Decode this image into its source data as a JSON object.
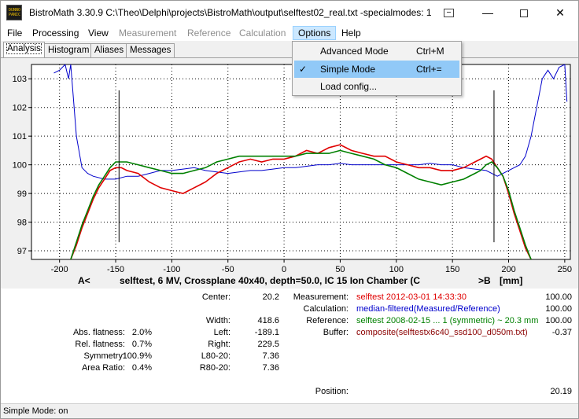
{
  "window": {
    "logo_text": [
      "DUNNO",
      "PANIC"
    ],
    "title": "BistroMath 3.30.9   C:\\Theo\\Delphi\\projects\\BistroMath\\output\\selftest02_real.txt -specialmodes: 1",
    "minimize_glyph": "—",
    "close_glyph": "✕"
  },
  "menu": {
    "file": "File",
    "processing": "Processing",
    "view": "View",
    "measurement": "Measurement",
    "reference": "Reference",
    "calculation": "Calculation",
    "options": "Options",
    "help": "Help"
  },
  "tabs": {
    "analysis": "Analysis",
    "histogram": "Histogram",
    "aliases": "Aliases",
    "messages": "Messages"
  },
  "options_menu": {
    "advanced_mode": "Advanced Mode",
    "advanced_shortcut": "Ctrl+M",
    "simple_mode": "Simple Mode",
    "simple_shortcut": "Ctrl+=",
    "simple_checked": true,
    "check_glyph": "✓",
    "load_config": "Load config..."
  },
  "chart_data": {
    "type": "line",
    "title": "selftest, 6 MV, Crossplane 40x40, depth=50.0, IC 15 Ion Chamber (C",
    "left_marker": "A<",
    "right_marker": ">B",
    "xlabel": "[mm]",
    "xlim": [
      -225,
      255
    ],
    "ylim": [
      96.7,
      103.5
    ],
    "x_ticks": [
      -200,
      -150,
      -100,
      -50,
      0,
      50,
      100,
      150,
      200,
      250
    ],
    "y_ticks": [
      97,
      98,
      99,
      100,
      101,
      102,
      103
    ],
    "markers_x": [
      -147,
      187
    ],
    "series": [
      {
        "color": "#0000cc",
        "x": [
          -205,
          -200,
          -195,
          -192,
          -190,
          -188,
          -185,
          -180,
          -175,
          -170,
          -160,
          -150,
          -140,
          -130,
          -120,
          -110,
          -100,
          -90,
          -80,
          -70,
          -60,
          -50,
          -40,
          -30,
          -20,
          -10,
          0,
          10,
          20,
          30,
          40,
          50,
          60,
          70,
          80,
          90,
          100,
          110,
          120,
          130,
          140,
          150,
          160,
          170,
          180,
          190,
          200,
          210,
          215,
          220,
          225,
          230,
          235,
          240,
          245,
          250,
          252
        ],
        "y": [
          103.2,
          103.3,
          103.5,
          103.0,
          103.5,
          102.5,
          101.0,
          99.9,
          99.7,
          99.6,
          99.5,
          99.5,
          99.6,
          99.6,
          99.7,
          99.8,
          99.8,
          99.85,
          99.9,
          99.8,
          99.75,
          99.7,
          99.75,
          99.8,
          99.8,
          99.85,
          99.9,
          99.9,
          99.95,
          100.0,
          100.0,
          100.05,
          100.0,
          100.0,
          100.0,
          100.0,
          100.0,
          100.0,
          100.0,
          100.05,
          100.0,
          100.0,
          99.9,
          99.85,
          99.8,
          99.6,
          99.8,
          100.0,
          100.3,
          101.0,
          102.0,
          103.0,
          103.3,
          103.0,
          103.4,
          103.5,
          102.2
        ]
      },
      {
        "color": "#e00000",
        "x": [
          -190,
          -185,
          -180,
          -175,
          -170,
          -165,
          -160,
          -155,
          -150,
          -145,
          -140,
          -130,
          -120,
          -110,
          -100,
          -90,
          -80,
          -70,
          -60,
          -50,
          -40,
          -30,
          -20,
          -10,
          0,
          10,
          20,
          30,
          40,
          50,
          60,
          70,
          80,
          90,
          100,
          110,
          120,
          130,
          140,
          150,
          160,
          170,
          175,
          180,
          185,
          190,
          195,
          200,
          205,
          210,
          215,
          220
        ],
        "y": [
          96.7,
          97.2,
          97.8,
          98.3,
          98.8,
          99.2,
          99.5,
          99.8,
          99.9,
          99.9,
          99.8,
          99.7,
          99.4,
          99.2,
          99.1,
          99.0,
          99.2,
          99.4,
          99.7,
          99.9,
          100.1,
          100.2,
          100.1,
          100.2,
          100.2,
          100.3,
          100.5,
          100.4,
          100.6,
          100.7,
          100.5,
          100.4,
          100.3,
          100.3,
          100.1,
          100.0,
          99.9,
          99.9,
          99.8,
          99.8,
          99.9,
          100.1,
          100.2,
          100.3,
          100.2,
          99.9,
          99.6,
          99.0,
          98.3,
          97.7,
          97.1,
          96.7
        ]
      },
      {
        "color": "#008000",
        "x": [
          -190,
          -185,
          -180,
          -175,
          -170,
          -165,
          -160,
          -155,
          -150,
          -145,
          -140,
          -130,
          -120,
          -110,
          -100,
          -90,
          -80,
          -70,
          -60,
          -50,
          -40,
          -30,
          -20,
          -10,
          0,
          10,
          20,
          30,
          40,
          50,
          60,
          70,
          80,
          90,
          100,
          110,
          120,
          130,
          140,
          150,
          160,
          170,
          175,
          180,
          185,
          190,
          195,
          200,
          205,
          210,
          215,
          220
        ],
        "y": [
          96.7,
          97.3,
          97.9,
          98.4,
          98.9,
          99.3,
          99.6,
          99.9,
          100.1,
          100.1,
          100.1,
          100.0,
          99.9,
          99.8,
          99.7,
          99.7,
          99.8,
          99.9,
          100.1,
          100.2,
          100.3,
          100.3,
          100.3,
          100.3,
          100.3,
          100.3,
          100.4,
          100.4,
          100.4,
          100.5,
          100.4,
          100.3,
          100.2,
          100.0,
          99.9,
          99.7,
          99.5,
          99.4,
          99.3,
          99.4,
          99.5,
          99.7,
          99.8,
          100.0,
          100.1,
          99.9,
          99.6,
          99.1,
          98.4,
          97.8,
          97.2,
          96.7
        ]
      }
    ]
  },
  "analysis": {
    "center_label": "Center:",
    "center": "20.2",
    "width_label": "Width:",
    "width": "418.6",
    "left_label": "Left:",
    "left": "-189.1",
    "right_label": "Right:",
    "right": "229.5",
    "l80_label": "L80-20:",
    "l80": "7.36",
    "r80_label": "R80-20:",
    "r80": "7.36",
    "abs_flatness_label": "Abs. flatness:",
    "abs_flatness": "2.0%",
    "rel_flatness_label": "Rel. flatness:",
    "rel_flatness": "0.7%",
    "symmetry_label": "Symmetry:",
    "symmetry": "100.9%",
    "area_ratio_label": "Area Ratio:",
    "area_ratio": "0.4%",
    "measurement_label": "Measurement:",
    "measurement": "selftest 2012-03-01 14:33:30",
    "measurement_value": "100.00",
    "calculation_label": "Calculation:",
    "calculation": "median-filtered(Measured/Reference)",
    "calculation_value": "100.00",
    "reference_label": "Reference:",
    "reference": "selftest 2008-02-15  ... 1 (symmetric) ~ 20.3 mm",
    "reference_value": "100.00",
    "buffer_label": "Buffer:",
    "buffer": "composite(selftestx6c40_ssd100_d050m.txt)",
    "buffer_value": "-0.37",
    "position_label": "Position:",
    "position": "20.19",
    "colors": {
      "measurement": "#e00000",
      "calculation": "#0000cc",
      "reference": "#008000",
      "buffer": "#8b0000"
    }
  },
  "status": {
    "text": "Simple Mode: on"
  }
}
